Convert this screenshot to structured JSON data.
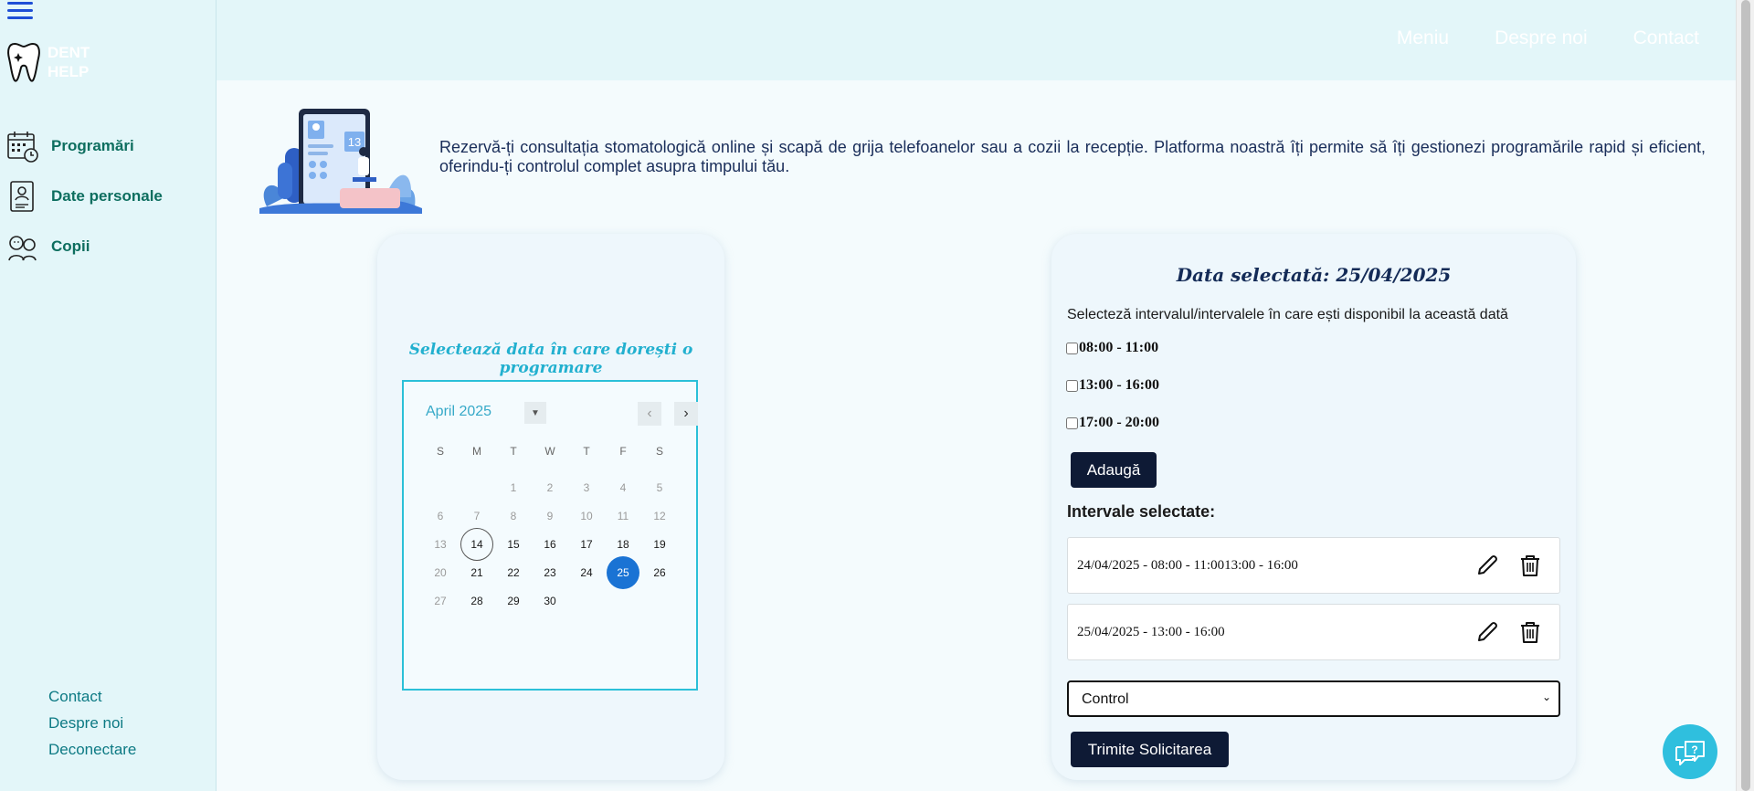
{
  "app": {
    "logo_line1": "DENT",
    "logo_line2": "HELP"
  },
  "sidebar": {
    "items": [
      {
        "label": "Programări",
        "icon": "calendar-icon"
      },
      {
        "label": "Date personale",
        "icon": "profile-icon"
      },
      {
        "label": "Copii",
        "icon": "children-icon"
      }
    ],
    "footer": [
      "Contact",
      "Despre noi",
      "Deconectare"
    ]
  },
  "topnav": [
    "Meniu",
    "Despre noi",
    "Contact"
  ],
  "intro": {
    "text": "Rezervă-ți consultația stomatologică online și scapă de grija telefoanelor sau a cozii la recepție. Platforma noastră îți permite să îți gestionezi programările rapid și eficient, oferindu-ți controlul complet asupra timpului tău.",
    "illustration_date": "13"
  },
  "calendar": {
    "heading": "Selectează data în care dorești o programare",
    "month_label": "April 2025",
    "days_of_week": [
      "S",
      "M",
      "T",
      "W",
      "T",
      "F",
      "S"
    ],
    "weeks": [
      [
        "",
        "",
        "1",
        "2",
        "3",
        "4",
        "5"
      ],
      [
        "6",
        "7",
        "8",
        "9",
        "10",
        "11",
        "12"
      ],
      [
        "13",
        "14",
        "15",
        "16",
        "17",
        "18",
        "19"
      ],
      [
        "20",
        "21",
        "22",
        "23",
        "24",
        "25",
        "26"
      ],
      [
        "27",
        "28",
        "29",
        "30",
        "",
        "",
        ""
      ]
    ],
    "today": "14",
    "selected": "25",
    "accent_color": "#1a73d4"
  },
  "selection": {
    "title": "Data selectată: 25/04/2025",
    "instruction": "Selecteză intervalul/intervalele în care ești disponibil la această dată",
    "slots": [
      "08:00 - 11:00",
      "13:00 - 16:00",
      "17:00 - 20:00"
    ],
    "add_label": "Adaugă",
    "selected_heading": "Intervale selectate:",
    "intervals": [
      "24/04/2025 - 08:00 - 11:0013:00 - 16:00",
      "25/04/2025 - 13:00 - 16:00"
    ],
    "type_value": "Control",
    "submit_label": "Trimite Solicitarea"
  }
}
